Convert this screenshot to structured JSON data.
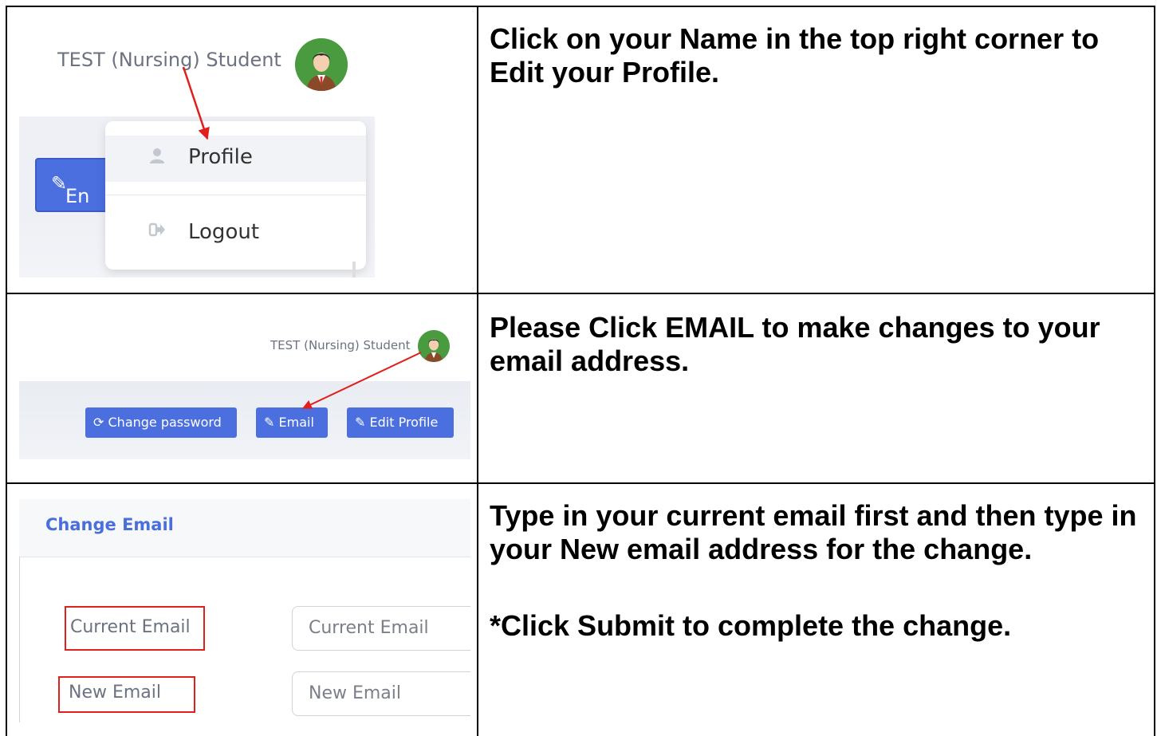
{
  "rows": [
    {
      "instruction": [
        "Click on your Name in the top right corner to Edit your Profile."
      ],
      "screenshot": {
        "user_name": "TEST (Nursing) Student",
        "background_button": "En",
        "menu": [
          {
            "label": "Profile",
            "icon": "user-icon"
          },
          {
            "label": "Logout",
            "icon": "sign-out-icon"
          }
        ]
      }
    },
    {
      "instruction": [
        "Please Click EMAIL to make changes to your email address."
      ],
      "screenshot": {
        "user_name": "TEST (Nursing) Student",
        "buttons": [
          {
            "label": "Change password",
            "icon": "refresh-icon"
          },
          {
            "label": "Email",
            "icon": "edit-icon"
          },
          {
            "label": "Edit Profile",
            "icon": "edit-icon"
          }
        ]
      }
    },
    {
      "instruction": [
        "Type in your current email first and then type in your New email address for the change.",
        "*Click Submit to complete the change."
      ],
      "screenshot": {
        "card_title": "Change Email",
        "fields": [
          {
            "label": "Current Email",
            "placeholder": "Current Email"
          },
          {
            "label": "New Email",
            "placeholder": "New Email"
          }
        ]
      }
    }
  ],
  "colors": {
    "button_blue": "#4c6fe0",
    "title_blue": "#4a6fdc",
    "annotation_red": "#e0201c",
    "avatar_green": "#4a9a3f"
  }
}
